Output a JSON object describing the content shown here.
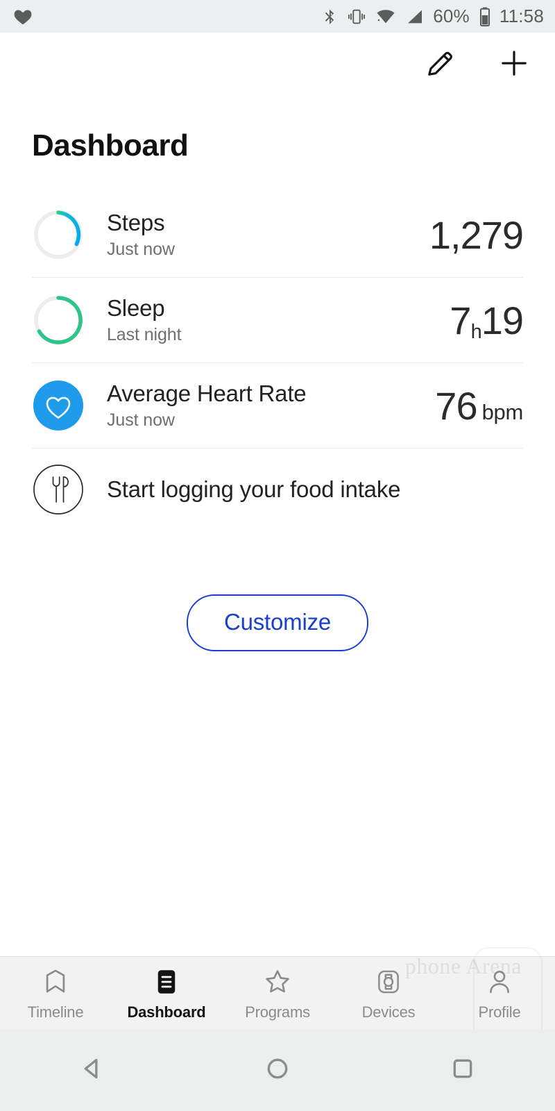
{
  "status_bar": {
    "notification_icon": "heart-icon",
    "icons": [
      "bluetooth-icon",
      "vibrate-icon",
      "wifi-icon",
      "signal-icon"
    ],
    "battery_percent": "60%",
    "battery_icon": "battery-icon",
    "time": "11:58"
  },
  "app_bar": {
    "edit_icon": "pencil-icon",
    "add_icon": "plus-icon"
  },
  "page": {
    "title": "Dashboard"
  },
  "metrics": [
    {
      "icon": "steps-progress-ring",
      "label": "Steps",
      "subtitle": "Just now",
      "value": "1,279",
      "unit": "",
      "ring_color": "#0aa6f0",
      "ring_progress": 32
    },
    {
      "icon": "sleep-progress-ring",
      "label": "Sleep",
      "subtitle": "Last night",
      "value_hours": "7",
      "value_h_marker": "h",
      "value_minutes": "19",
      "ring_color": "#2fc48a",
      "ring_progress": 85
    },
    {
      "icon": "heart-rate-icon",
      "label": "Average Heart Rate",
      "subtitle": "Just now",
      "value": "76",
      "unit": "bpm",
      "icon_color": "#1f9bec"
    }
  ],
  "food_row": {
    "icon": "cutlery-icon",
    "label": "Start logging your food intake"
  },
  "customize": {
    "label": "Customize",
    "color": "#1a3fd0"
  },
  "bottom_nav": [
    {
      "icon": "timeline-bookmark-icon",
      "label": "Timeline",
      "active": false
    },
    {
      "icon": "dashboard-list-icon",
      "label": "Dashboard",
      "active": true
    },
    {
      "icon": "star-icon",
      "label": "Programs",
      "active": false
    },
    {
      "icon": "watch-device-icon",
      "label": "Devices",
      "active": false
    },
    {
      "icon": "person-icon",
      "label": "Profile",
      "active": false
    }
  ],
  "system_nav": {
    "back_icon": "back-triangle-icon",
    "home_icon": "home-circle-icon",
    "recents_icon": "recents-square-icon"
  },
  "watermark": {
    "text": "phone Arena"
  }
}
